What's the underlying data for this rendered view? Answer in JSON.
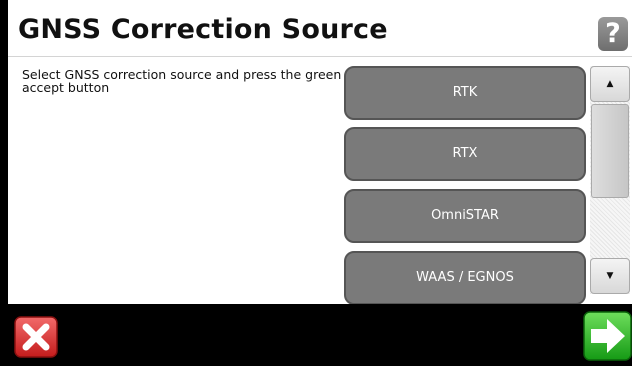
{
  "header": {
    "title": "GNSS Correction Source",
    "help_label": "?"
  },
  "instruction": "Select GNSS correction source and press the green accept button",
  "options": [
    {
      "label": "RTK",
      "selected": true
    },
    {
      "label": "RTX",
      "selected": false
    },
    {
      "label": "OmniSTAR",
      "selected": false
    },
    {
      "label": "WAAS / EGNOS",
      "selected": false
    }
  ],
  "scrollbar": {
    "up_glyph": "▲",
    "down_glyph": "▼"
  },
  "footer": {
    "cancel_icon": "x-icon",
    "accept_icon": "arrow-right-icon"
  },
  "colors": {
    "selected": "#19b319",
    "unselected": "#7a7a7a",
    "cancel": "#e53030",
    "accept": "#22b822"
  }
}
